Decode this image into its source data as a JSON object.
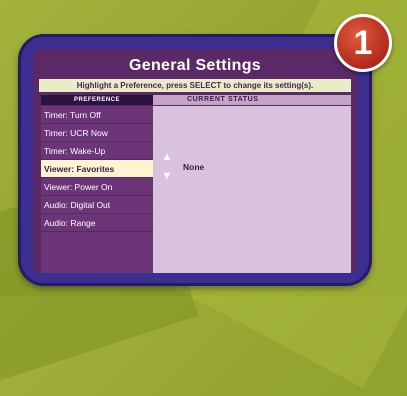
{
  "badge": {
    "number": "1"
  },
  "settings": {
    "title": "General Settings",
    "instruction": "Highlight a Preference, press SELECT to change its setting(s).",
    "columns": {
      "preference": "PREFERENCE",
      "status": "CURRENT STATUS"
    },
    "preferences": [
      {
        "label": "Timer: Turn Off",
        "selected": false
      },
      {
        "label": "Timer: UCR Now",
        "selected": false
      },
      {
        "label": "Timer: Wake-Up",
        "selected": false
      },
      {
        "label": "Viewer: Favorites",
        "selected": true
      },
      {
        "label": "Viewer: Power On",
        "selected": false
      },
      {
        "label": "Audio: Digital Out",
        "selected": false
      },
      {
        "label": "Audio: Range",
        "selected": false
      }
    ],
    "current_status": "None"
  },
  "colors": {
    "background": "#9aaa34",
    "frame": "#3a2f8f",
    "screen": "#5b2a66",
    "selected_row": "#fbf6cf",
    "badge": "#b12a1d"
  },
  "icons": {
    "up": "arrow-up-icon",
    "down": "arrow-down-icon"
  }
}
